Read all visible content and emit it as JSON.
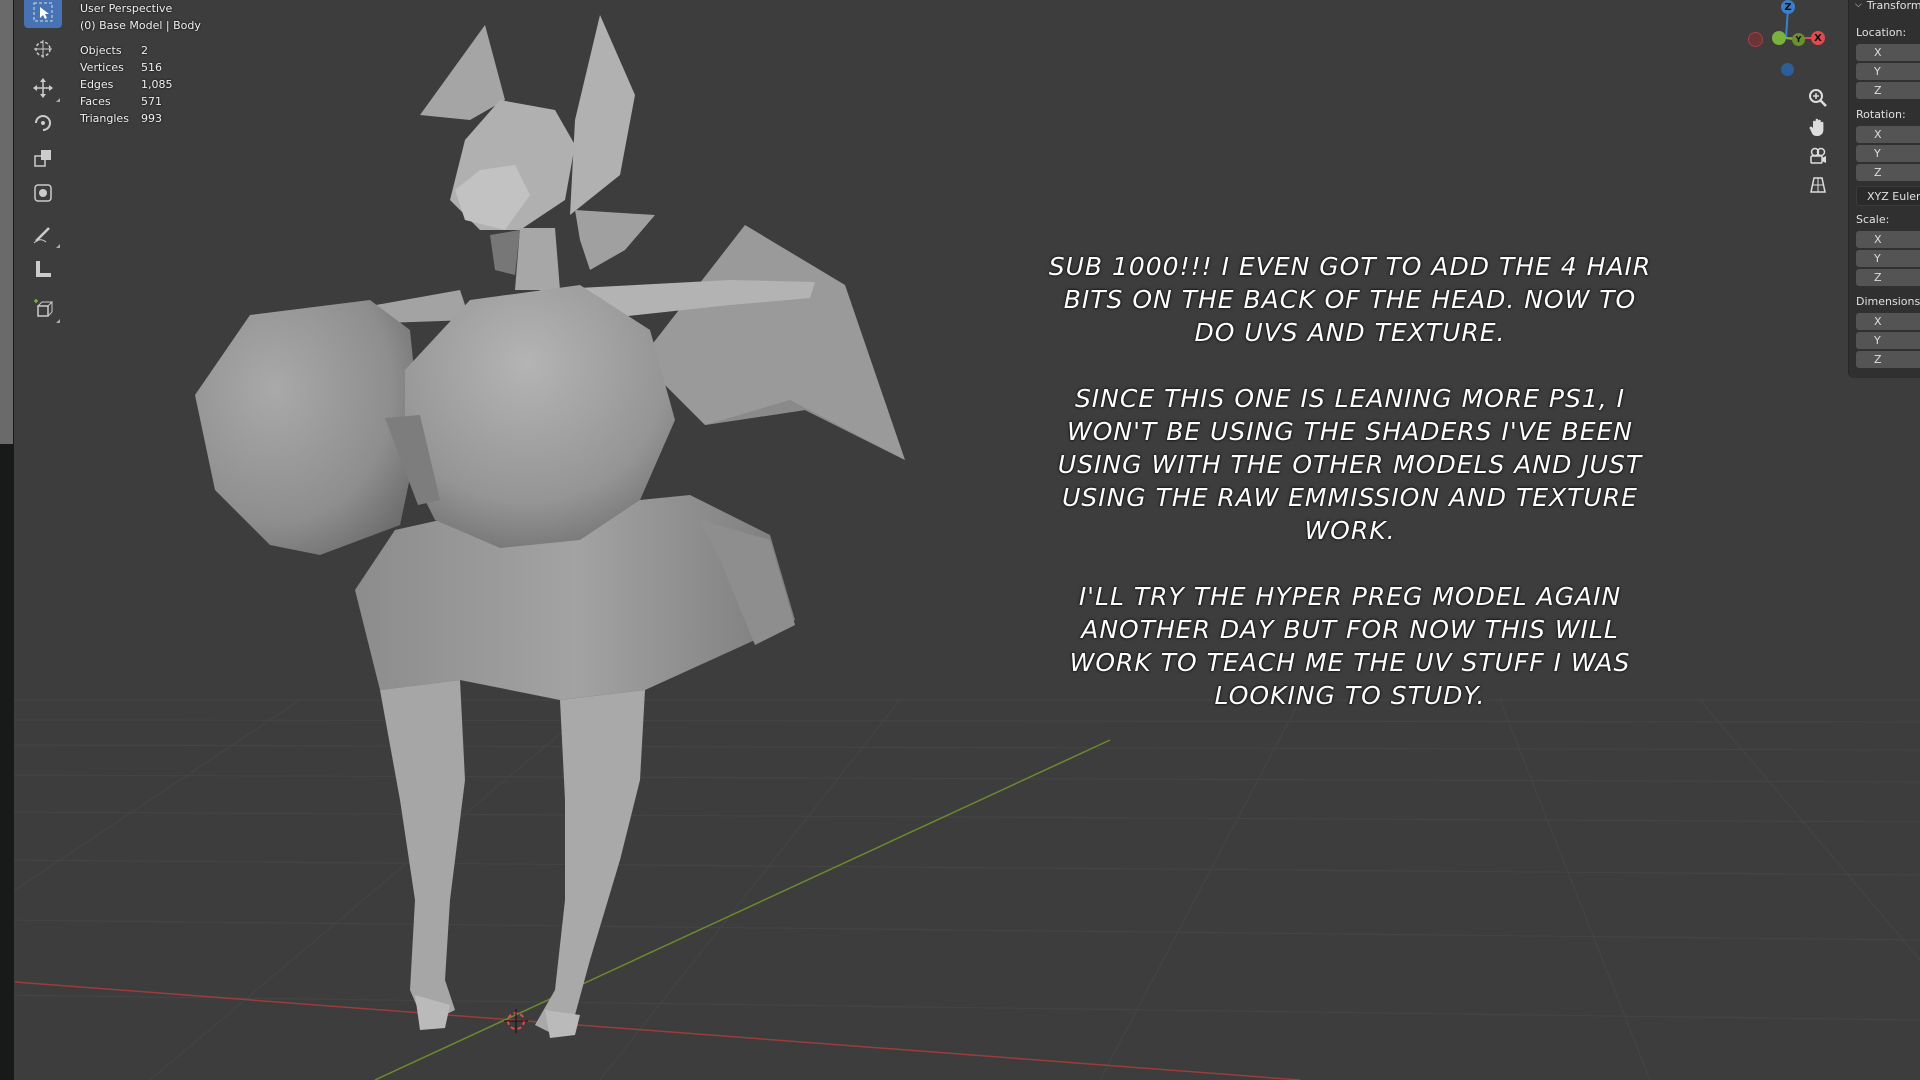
{
  "viewport": {
    "view_name": "User Perspective",
    "context": "(0) Base Model | Body"
  },
  "stats": [
    {
      "label": "Objects",
      "value": "2"
    },
    {
      "label": "Vertices",
      "value": "516"
    },
    {
      "label": "Edges",
      "value": "1,085"
    },
    {
      "label": "Faces",
      "value": "571"
    },
    {
      "label": "Triangles",
      "value": "993"
    }
  ],
  "gizmo": {
    "z_label": "Z",
    "y_label": "Y",
    "x_label": "X",
    "colors": {
      "x": "#e34a4f",
      "y": "#7bb23d",
      "z": "#3b7fcc"
    }
  },
  "tools": [
    {
      "name": "select-box",
      "icon": "cursor-select-icon",
      "active": true
    },
    {
      "name": "cursor",
      "icon": "3d-cursor-icon"
    },
    {
      "name": "move",
      "icon": "move-arrows-icon"
    },
    {
      "name": "rotate",
      "icon": "rotate-icon"
    },
    {
      "name": "scale",
      "icon": "scale-icon"
    },
    {
      "name": "transform",
      "icon": "transform-icon"
    },
    {
      "name": "annotate",
      "icon": "annotate-pen-icon"
    },
    {
      "name": "measure",
      "icon": "ruler-icon"
    },
    {
      "name": "add-cube",
      "icon": "add-cube-icon"
    }
  ],
  "nav_icons": [
    "zoom-icon",
    "hand-pan-icon",
    "camera-icon",
    "grid-ortho-icon"
  ],
  "npanel": {
    "header": "Transform",
    "location_label": "Location:",
    "rotation_label": "Rotation:",
    "rotation_mode": "XYZ Euler",
    "scale_label": "Scale:",
    "dimensions_label": "Dimensions:",
    "axes": [
      "X",
      "Y",
      "Z"
    ]
  },
  "caption": {
    "p1": "SUB 1000!!! I EVEN GOT TO ADD THE 4 HAIR BITS ON THE BACK OF THE HEAD. NOW TO DO UVS AND TEXTURE.",
    "p2": "SINCE THIS ONE IS LEANING MORE PS1, I WON'T BE USING THE SHADERS I'VE BEEN USING WITH THE OTHER MODELS AND JUST USING THE RAW EMMISSION AND TEXTURE WORK.",
    "p3": "I'LL TRY THE HYPER PREG MODEL AGAIN ANOTHER DAY BUT FOR NOW THIS WILL WORK TO TEACH ME THE UV STUFF I WAS LOOKING TO STUDY."
  }
}
